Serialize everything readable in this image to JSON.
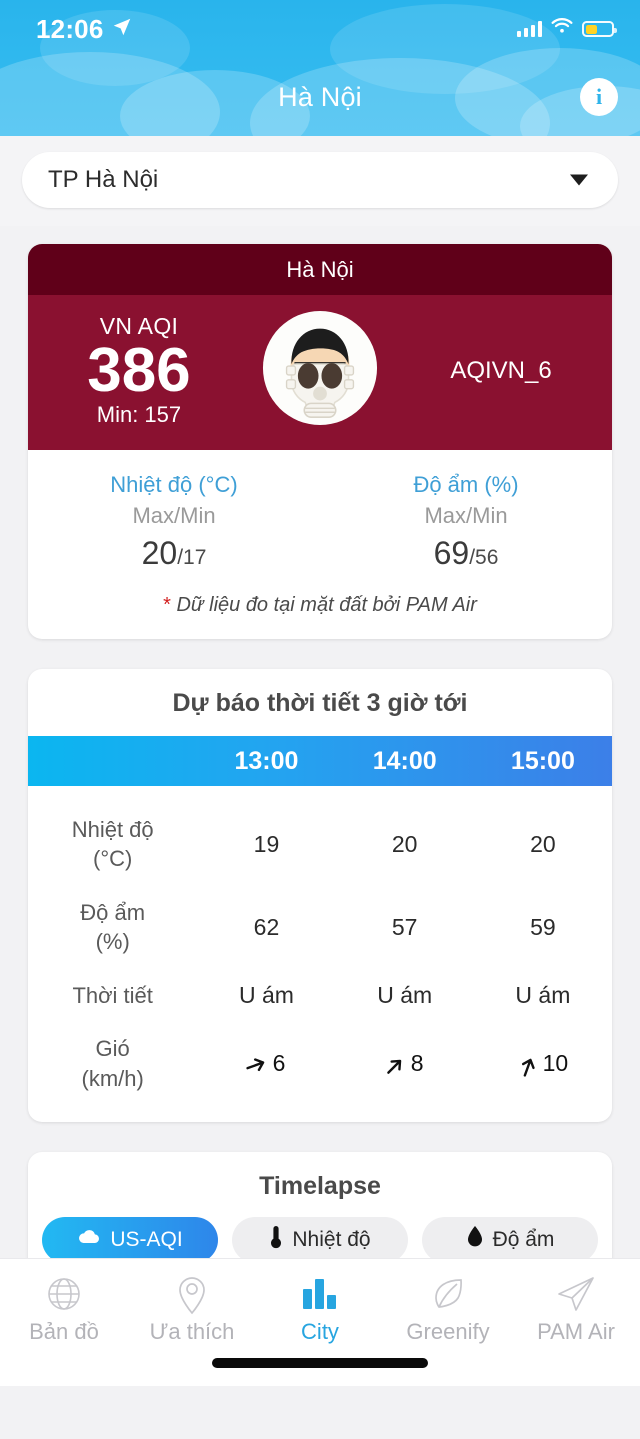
{
  "status_bar": {
    "time": "12:06",
    "location_icon": "location-arrow-icon",
    "signal_icon": "cellular-signal-icon",
    "wifi_icon": "wifi-icon",
    "battery_icon": "battery-low-power-icon",
    "battery_level_percent": 45,
    "battery_color": "#ffd324"
  },
  "header": {
    "title": "Hà Nội",
    "info_label": "i",
    "info_icon": "info-circle-icon",
    "background_color": "#2fb8ee"
  },
  "city_select": {
    "value": "TP Hà Nội",
    "placeholder": "TP Hà Nội",
    "caret_icon": "chevron-down-icon"
  },
  "aqi_card": {
    "station_title": "Hà Nội",
    "index_label": "VN AQI",
    "index_value": "386",
    "min_label": "Min: 157",
    "station_code": "AQIVN_6",
    "mask_icon": "gas-mask-face-icon",
    "header_color": "#600019",
    "body_color": "#8a1130",
    "metrics": [
      {
        "title": "Nhiệt độ (°C)",
        "sub": "Max/Min",
        "max": "20",
        "min": "/17"
      },
      {
        "title": "Độ ẩm (%)",
        "sub": "Max/Min",
        "max": "69",
        "min": "/56"
      }
    ],
    "note_asterisk": "*",
    "note": " Dữ liệu đo tại mặt đất bởi PAM Air",
    "label_color": "#3f9fd6"
  },
  "forecast": {
    "title": "Dự báo thời tiết 3 giờ tới",
    "hours": [
      "13:00",
      "14:00",
      "15:00"
    ],
    "rows": [
      {
        "label_line1": "Nhiệt độ",
        "label_line2": "(°C)",
        "values": [
          "19",
          "20",
          "20"
        ]
      },
      {
        "label_line1": "Độ ẩm",
        "label_line2": "(%)",
        "values": [
          "62",
          "57",
          "59"
        ]
      },
      {
        "label_line1": "Thời tiết",
        "label_line2": "",
        "values": [
          "U ám",
          "U ám",
          "U ám"
        ]
      },
      {
        "label_line1": "Gió",
        "label_line2": "(km/h)",
        "values": [
          "6",
          "8",
          "10"
        ],
        "icon": "wind-direction-arrow-icon",
        "angles": [
          250,
          225,
          200
        ]
      }
    ],
    "header_gradient_from": "#0bb6f0",
    "header_gradient_to": "#3c7fe8"
  },
  "timelapse": {
    "title": "Timelapse",
    "tabs": [
      {
        "label": "US-AQI",
        "icon": "cloud-icon",
        "active": true
      },
      {
        "label": "Nhiệt độ",
        "icon": "thermometer-icon",
        "active": false
      },
      {
        "label": "Độ ẩm",
        "icon": "water-drop-icon",
        "active": false
      }
    ],
    "map_alt": "map-preview"
  },
  "tabbar": {
    "items": [
      {
        "label": "Bản đồ",
        "icon": "globe-icon",
        "active": false
      },
      {
        "label": "Ưa thích",
        "icon": "map-pin-icon",
        "active": false
      },
      {
        "label": "City",
        "icon": "bar-chart-icon",
        "active": true
      },
      {
        "label": "Greenify",
        "icon": "leaf-icon",
        "active": false
      },
      {
        "label": "PAM Air",
        "icon": "paper-plane-icon",
        "active": false
      }
    ],
    "active_color": "#27a5e0",
    "inactive_color": "#b3b3b8"
  }
}
